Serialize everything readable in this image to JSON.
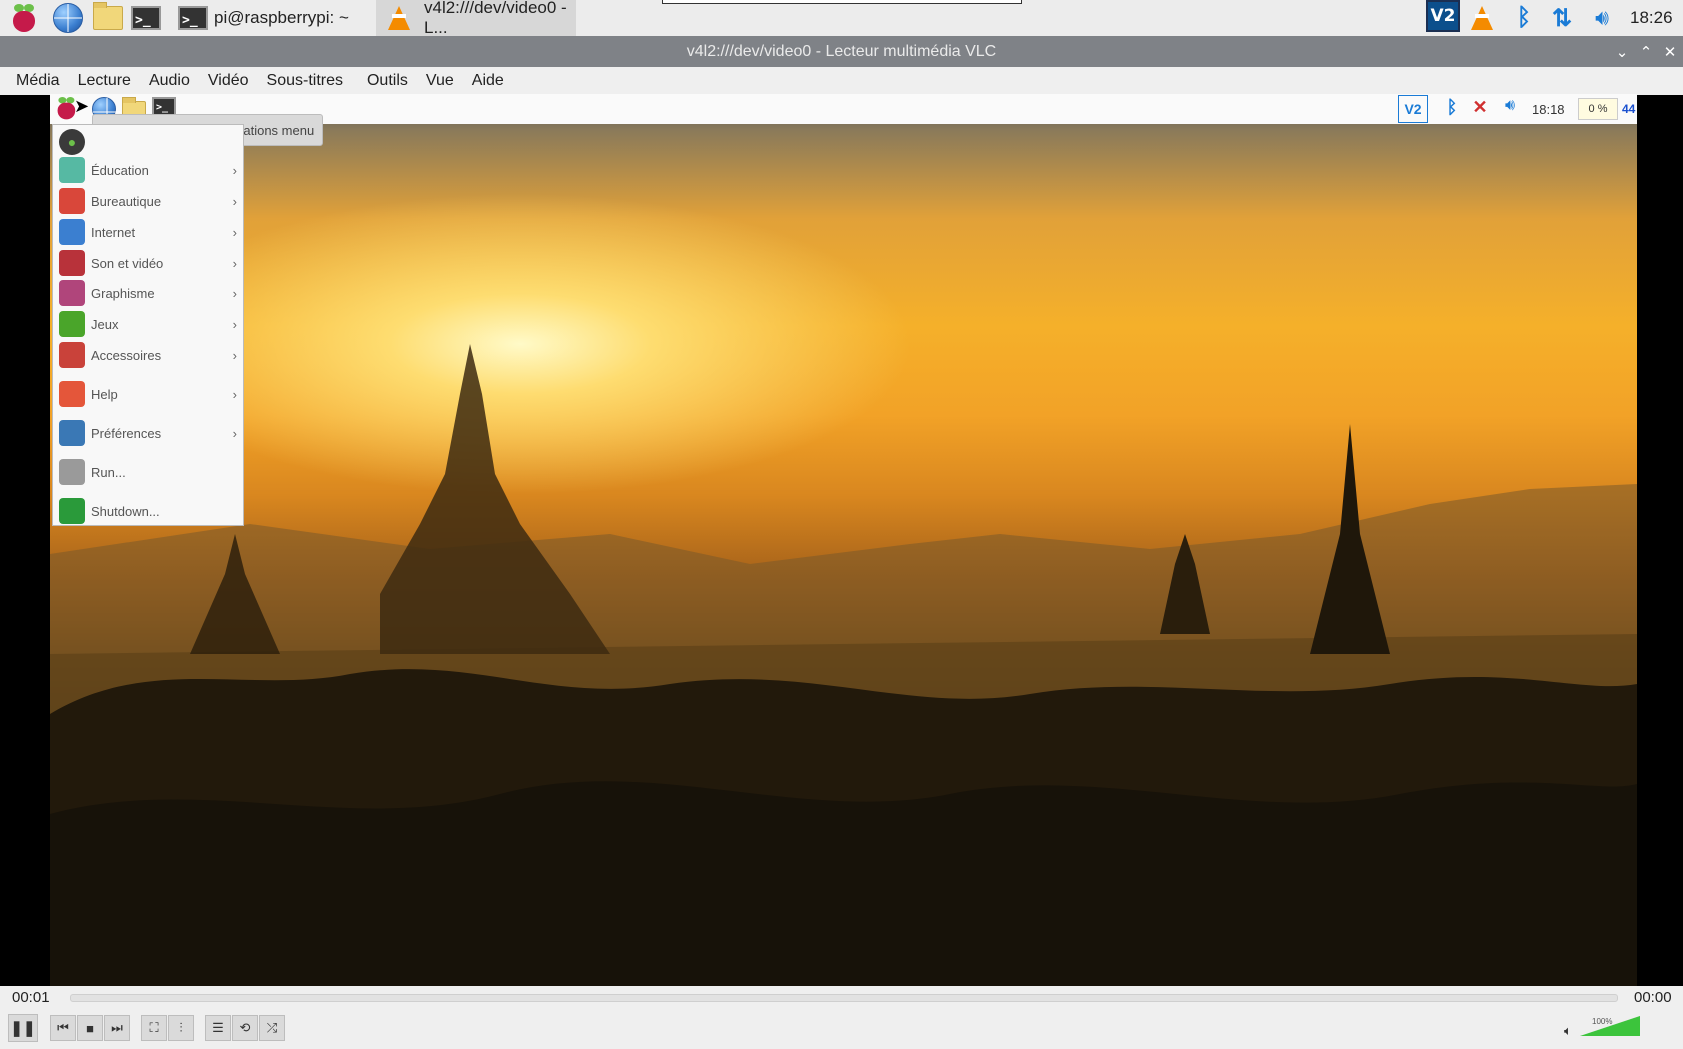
{
  "taskbar": {
    "tasks": [
      {
        "label": "pi@raspberrypi: ~",
        "icon": "terminal-icon"
      },
      {
        "label": "v4l2:///dev/video0 - L...",
        "icon": "vlc-cone-icon"
      }
    ],
    "tray_icons": [
      "vnc-icon",
      "vlc-cone-icon",
      "bluetooth-icon",
      "network-arrows-icon",
      "volume-icon"
    ],
    "clock": "18:26"
  },
  "window": {
    "title": "v4l2:///dev/video0 - Lecteur multimédia VLC"
  },
  "menubar": {
    "items": [
      "Média",
      "Lecture",
      "Audio",
      "Vidéo",
      "Sous-titres",
      "Outils",
      "Vue",
      "Aide"
    ]
  },
  "inner_desktop": {
    "tooltip": "Click here to open applications menu",
    "clock": "18:18",
    "cpu": "0 %",
    "extra": "44",
    "menu": [
      {
        "label": "Éducation",
        "icon": "education-flask-icon",
        "color": "#56b9a3",
        "arrow": "›"
      },
      {
        "label": "Bureautique",
        "icon": "office-icon",
        "color": "#d9473a",
        "arrow": "›"
      },
      {
        "label": "Internet",
        "icon": "internet-globe-icon",
        "color": "#3b7fd0",
        "arrow": "›"
      },
      {
        "label": "Son et vidéo",
        "icon": "sound-video-icon",
        "color": "#b8323a",
        "arrow": "›"
      },
      {
        "label": "Graphisme",
        "icon": "graphics-brush-icon",
        "color": "#b0457b",
        "arrow": "›"
      },
      {
        "label": "Jeux",
        "icon": "games-invader-icon",
        "color": "#4aa52a",
        "arrow": "›"
      },
      {
        "label": "Accessoires",
        "icon": "accessories-icon",
        "color": "#c9423a",
        "arrow": "›"
      },
      {
        "label": "Help",
        "icon": "help-lifebuoy-icon",
        "color": "#e4563a",
        "arrow": "›"
      },
      {
        "label": "Préférences",
        "icon": "preferences-icon",
        "color": "#3a78b5",
        "arrow": "›"
      },
      {
        "label": "Run...",
        "icon": "run-paperplane-icon",
        "color": "#9a9a9a",
        "arrow": ""
      },
      {
        "label": "Shutdown...",
        "icon": "shutdown-icon",
        "color": "#2a9a3a",
        "arrow": ""
      }
    ]
  },
  "playback": {
    "elapsed": "00:01",
    "remaining": "00:00",
    "progress": 0.0,
    "volume_label": "100%",
    "volume_level": 1.0
  }
}
